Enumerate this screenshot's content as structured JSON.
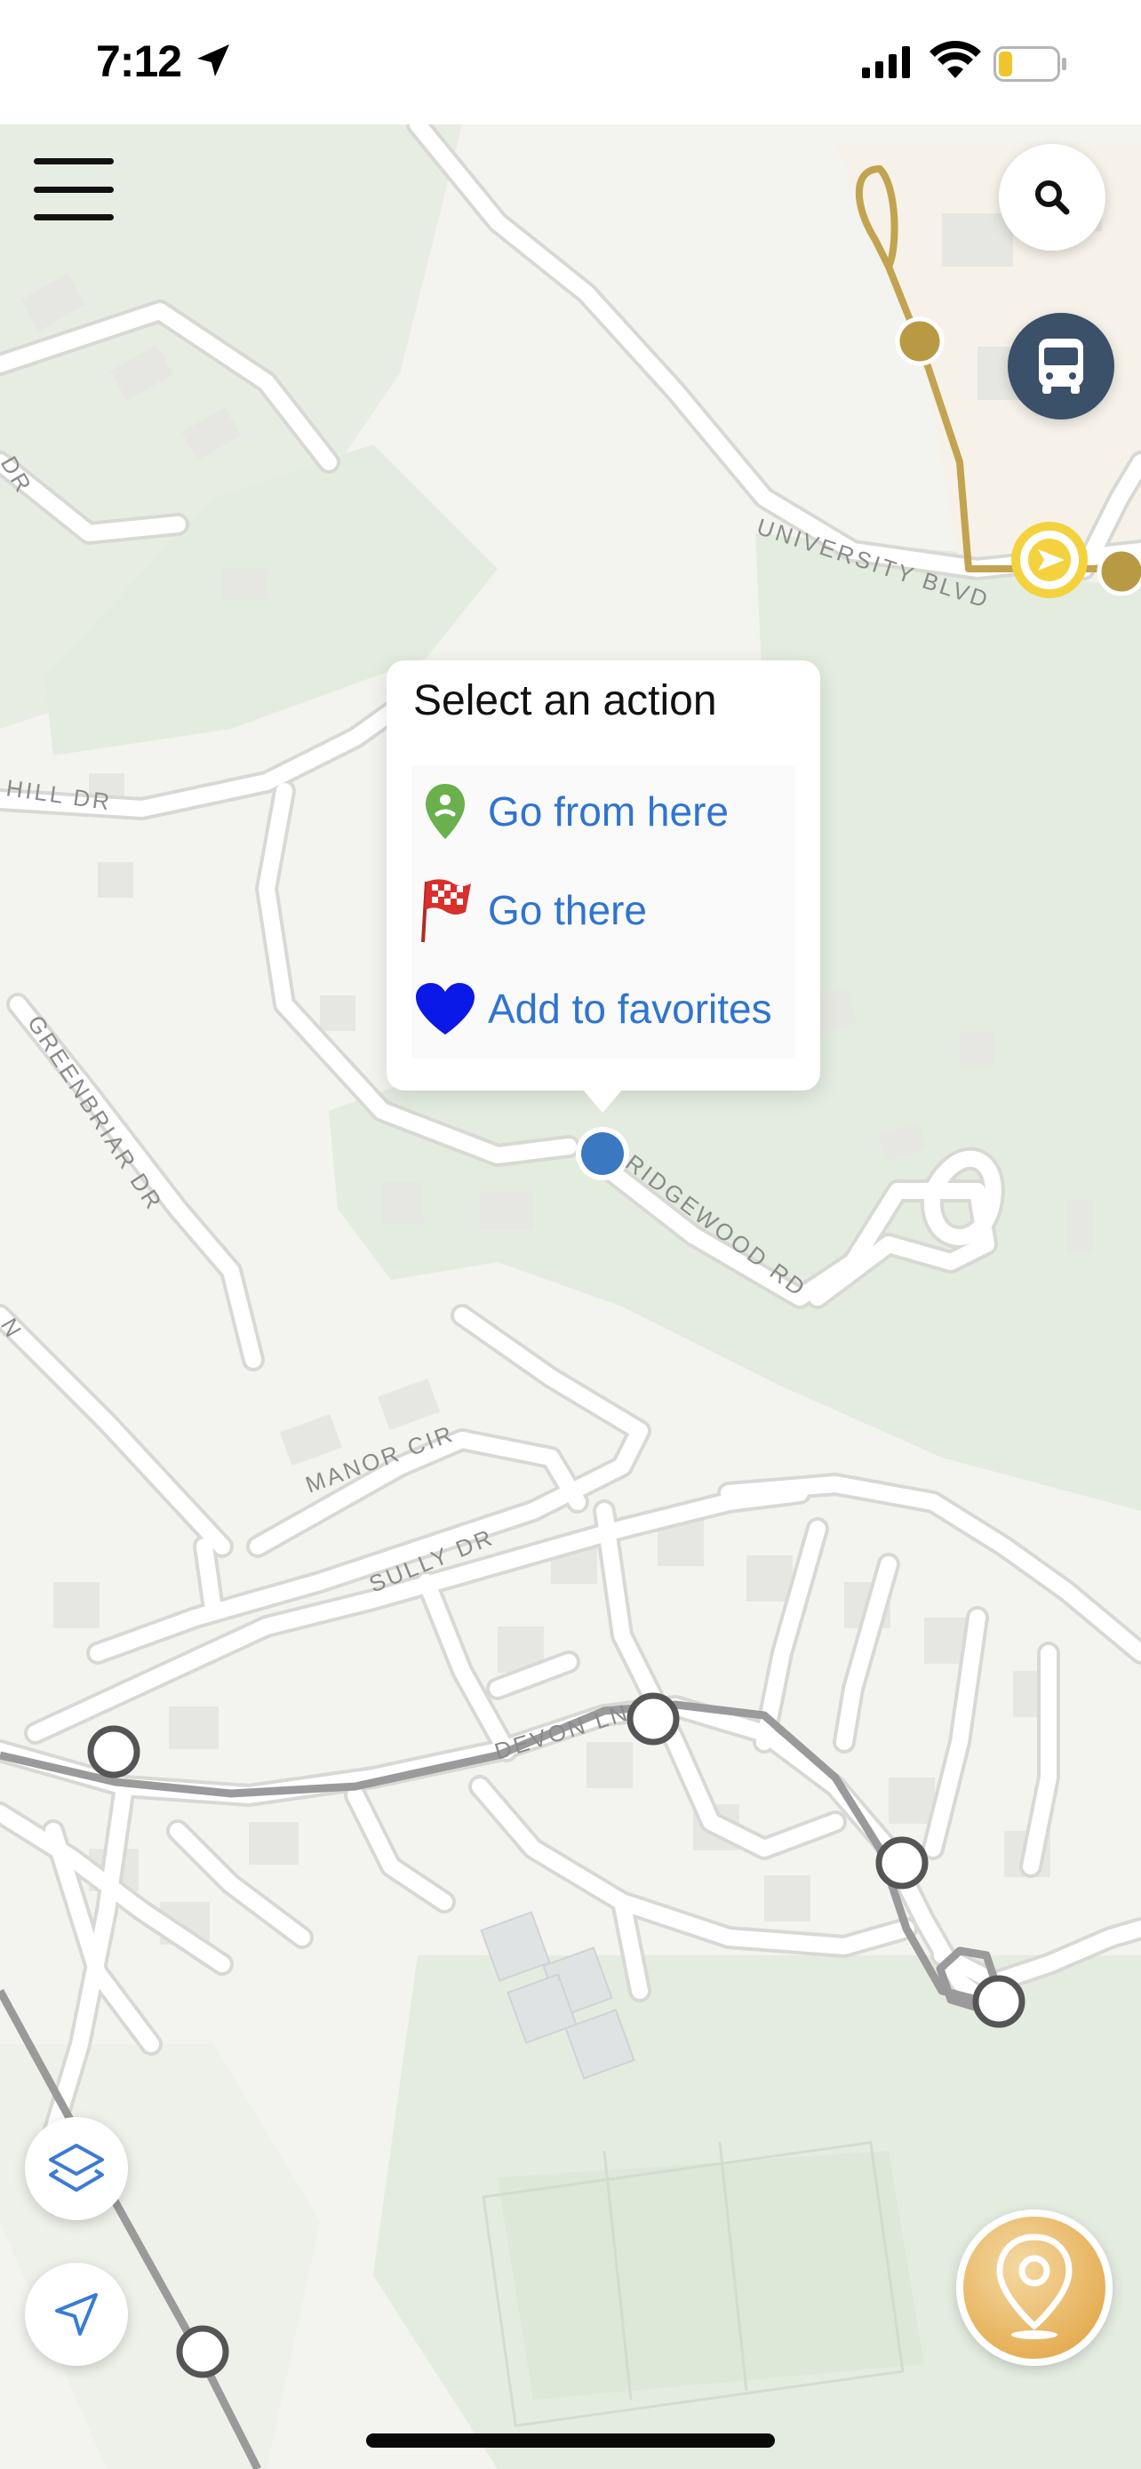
{
  "status_bar": {
    "time": "7:12",
    "battery_color": "#f0c52c"
  },
  "map": {
    "road_labels": {
      "university": "UNIVERSITY BLVD",
      "hill": "HILL DR",
      "greenbriar": "GREENBRIAR DR",
      "ridgewood": "RIDGEWOOD RD",
      "manor": "MANOR CIR",
      "sully": "SULLY DR",
      "devon": "DEVON LN",
      "partial_dr": "DR",
      "partial_n": "N"
    },
    "colors": {
      "land": "#f3f3ef",
      "park": "#e3ecdf",
      "road": "#ffffff",
      "road_edge": "#d8d8d4",
      "gold_route": "#c2a350",
      "gray_route": "#9a9a9a",
      "selected_point": "#3a78c2"
    }
  },
  "controls": {
    "menu_icon": "hamburger-menu-icon",
    "search_icon": "search-icon",
    "bus_icon": "bus-icon",
    "layers_icon": "layers-icon",
    "locate_icon": "navigation-arrow-icon",
    "pin_icon": "map-pin-icon"
  },
  "popup": {
    "title": "Select an action",
    "actions": [
      {
        "label": "Go from here",
        "icon": "green-pin-icon",
        "icon_color": "#6ab04c"
      },
      {
        "label": "Go there",
        "icon": "checkered-flag-icon",
        "icon_color": "#d9302c"
      },
      {
        "label": "Add to favorites",
        "icon": "heart-icon",
        "icon_color": "#0a18e8"
      }
    ]
  }
}
